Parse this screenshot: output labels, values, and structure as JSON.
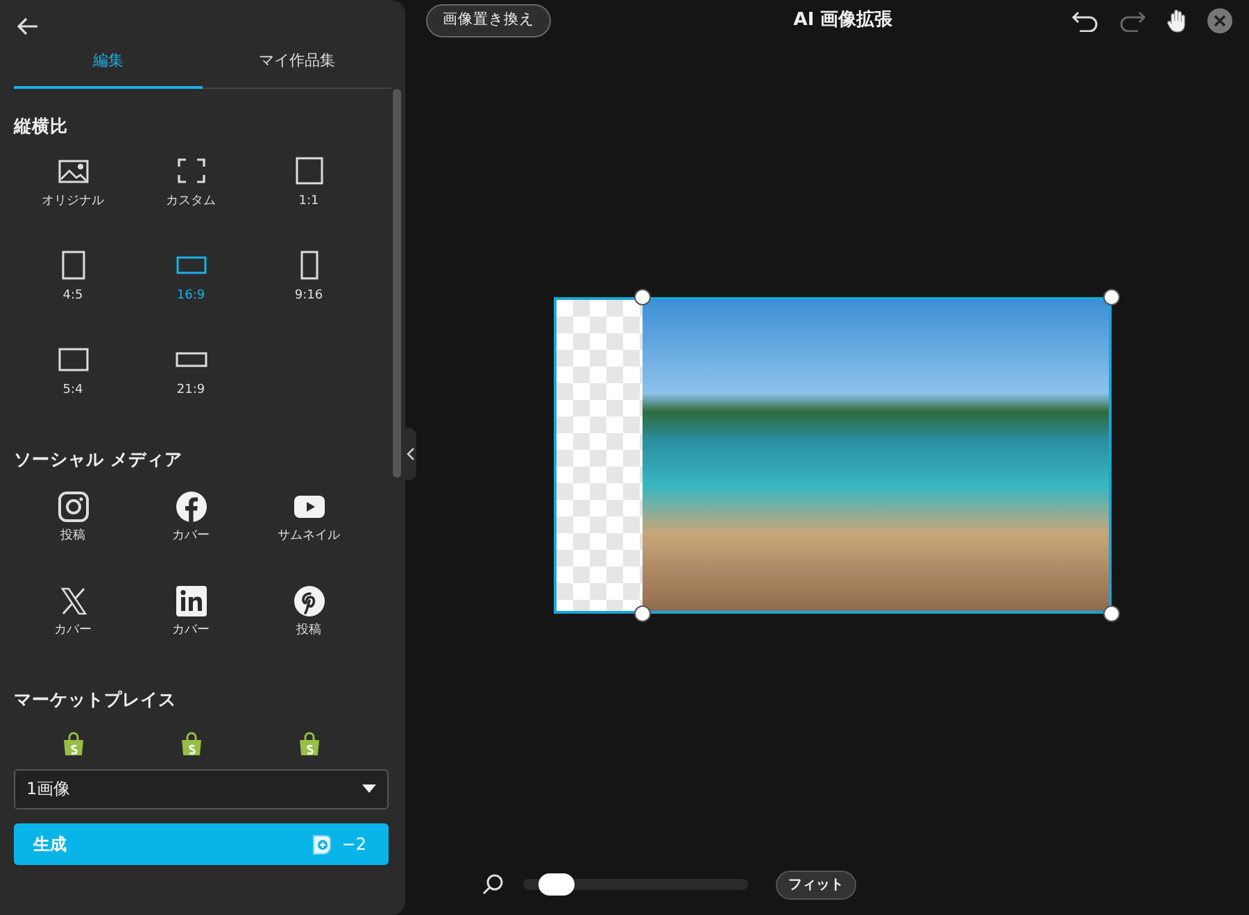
{
  "sidebar": {
    "tabs": [
      {
        "label": "編集",
        "selected": true
      },
      {
        "label": "マイ作品集",
        "selected": false
      }
    ],
    "sections": [
      {
        "title": "縦横比",
        "items": [
          {
            "kind": "original",
            "label": "オリジナル",
            "selected": false
          },
          {
            "kind": "custom",
            "label": "カスタム",
            "selected": false
          },
          {
            "kind": "r1x1",
            "label": "1:1",
            "selected": false
          },
          {
            "kind": "r4x5",
            "label": "4:5",
            "selected": false
          },
          {
            "kind": "r16x9",
            "label": "16:9",
            "selected": true
          },
          {
            "kind": "r9x16",
            "label": "9:16",
            "selected": false
          },
          {
            "kind": "r5x4",
            "label": "5:4",
            "selected": false
          },
          {
            "kind": "r21x9",
            "label": "21:9",
            "selected": false
          }
        ]
      },
      {
        "title": "ソーシャル メディア",
        "items": [
          {
            "kind": "instagram",
            "label": "投稿",
            "selected": false
          },
          {
            "kind": "facebook",
            "label": "カバー",
            "selected": false
          },
          {
            "kind": "youtube",
            "label": "サムネイル",
            "selected": false
          },
          {
            "kind": "x",
            "label": "カバー",
            "selected": false
          },
          {
            "kind": "linkedin",
            "label": "カバー",
            "selected": false
          },
          {
            "kind": "pinterest",
            "label": "投稿",
            "selected": false
          }
        ]
      },
      {
        "title": "マーケットプレイス",
        "items": [
          {
            "kind": "shopify"
          },
          {
            "kind": "shopify"
          },
          {
            "kind": "shopify"
          }
        ]
      }
    ],
    "count_select": {
      "value": "1画像"
    },
    "generate": {
      "label": "生成",
      "credits": "−2"
    }
  },
  "toolbar": {
    "replace_button": "画像置き換え",
    "title": "AI 画像拡張"
  },
  "zoom": {
    "level": 0.08,
    "fit_button": "フィット"
  }
}
